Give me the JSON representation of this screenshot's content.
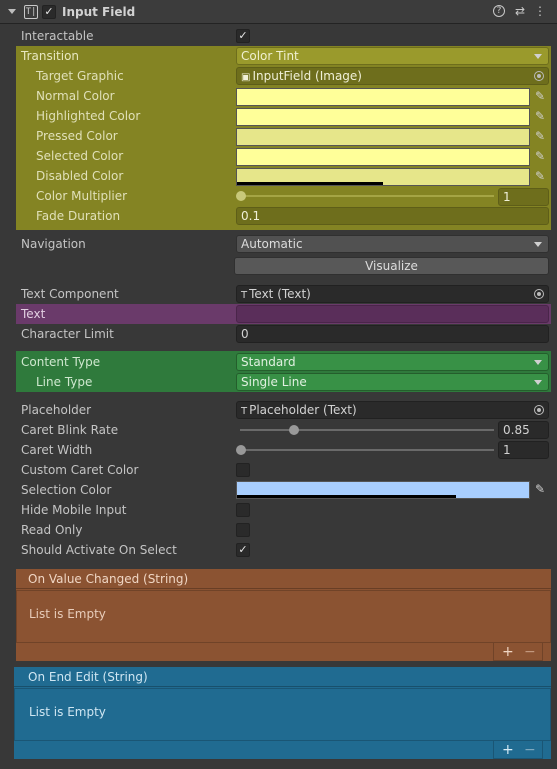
{
  "header": {
    "title": "Input Field",
    "enabled": true,
    "icons": [
      "chevron-down-icon",
      "component-icon",
      "help-icon",
      "preset-icon",
      "kebab-menu-icon"
    ]
  },
  "interactable": {
    "label": "Interactable",
    "checked": true
  },
  "transition": {
    "label": "Transition",
    "value": "Color Tint",
    "highlight": "#848423",
    "target_graphic": {
      "label": "Target Graphic",
      "value": "InputField (Image)"
    },
    "normal_color": {
      "label": "Normal Color",
      "color": "#ffff99"
    },
    "highlighted_color": {
      "label": "Highlighted Color",
      "color": "#ffff99"
    },
    "pressed_color": {
      "label": "Pressed Color",
      "color": "#e6e68a"
    },
    "selected_color": {
      "label": "Selected Color",
      "color": "#ffff99"
    },
    "disabled_color": {
      "label": "Disabled Color",
      "color": "#e6e68a",
      "alpha": 0.5
    },
    "color_multiplier": {
      "label": "Color Multiplier",
      "value": "1",
      "fraction": 0
    },
    "fade_duration": {
      "label": "Fade Duration",
      "value": "0.1"
    }
  },
  "navigation": {
    "label": "Navigation",
    "value": "Automatic",
    "visualize_label": "Visualize"
  },
  "text_component": {
    "label": "Text Component",
    "value": "Text (Text)"
  },
  "text": {
    "label": "Text",
    "value": "",
    "highlight": "#6a3a6a"
  },
  "character_limit": {
    "label": "Character Limit",
    "value": "0"
  },
  "content_type": {
    "label": "Content Type",
    "value": "Standard",
    "highlight": "#2f7a3c"
  },
  "line_type": {
    "label": "Line Type",
    "value": "Single Line"
  },
  "placeholder": {
    "label": "Placeholder",
    "value": "Placeholder (Text)"
  },
  "caret_blink_rate": {
    "label": "Caret Blink Rate",
    "value": "0.85",
    "fraction": 0.21
  },
  "caret_width": {
    "label": "Caret Width",
    "value": "1",
    "fraction": 0
  },
  "custom_caret_color": {
    "label": "Custom Caret Color",
    "checked": false
  },
  "selection_color": {
    "label": "Selection Color",
    "color": "#a8cefe",
    "alpha": 0.75
  },
  "hide_mobile_input": {
    "label": "Hide Mobile Input",
    "checked": false
  },
  "read_only": {
    "label": "Read Only",
    "checked": false
  },
  "should_activate_on_select": {
    "label": "Should Activate On Select",
    "checked": true
  },
  "on_value_changed": {
    "title": "On Value Changed (String)",
    "empty_text": "List is Empty",
    "color": "#8b5332"
  },
  "on_end_edit": {
    "title": "On End Edit (String)",
    "empty_text": "List is Empty",
    "color": "#206b91"
  },
  "symbols": {
    "check": "✓",
    "plus": "+",
    "minus": "−",
    "eyedropper": "✎",
    "help": "?",
    "preset": "⇄",
    "kebab": "⋮"
  }
}
